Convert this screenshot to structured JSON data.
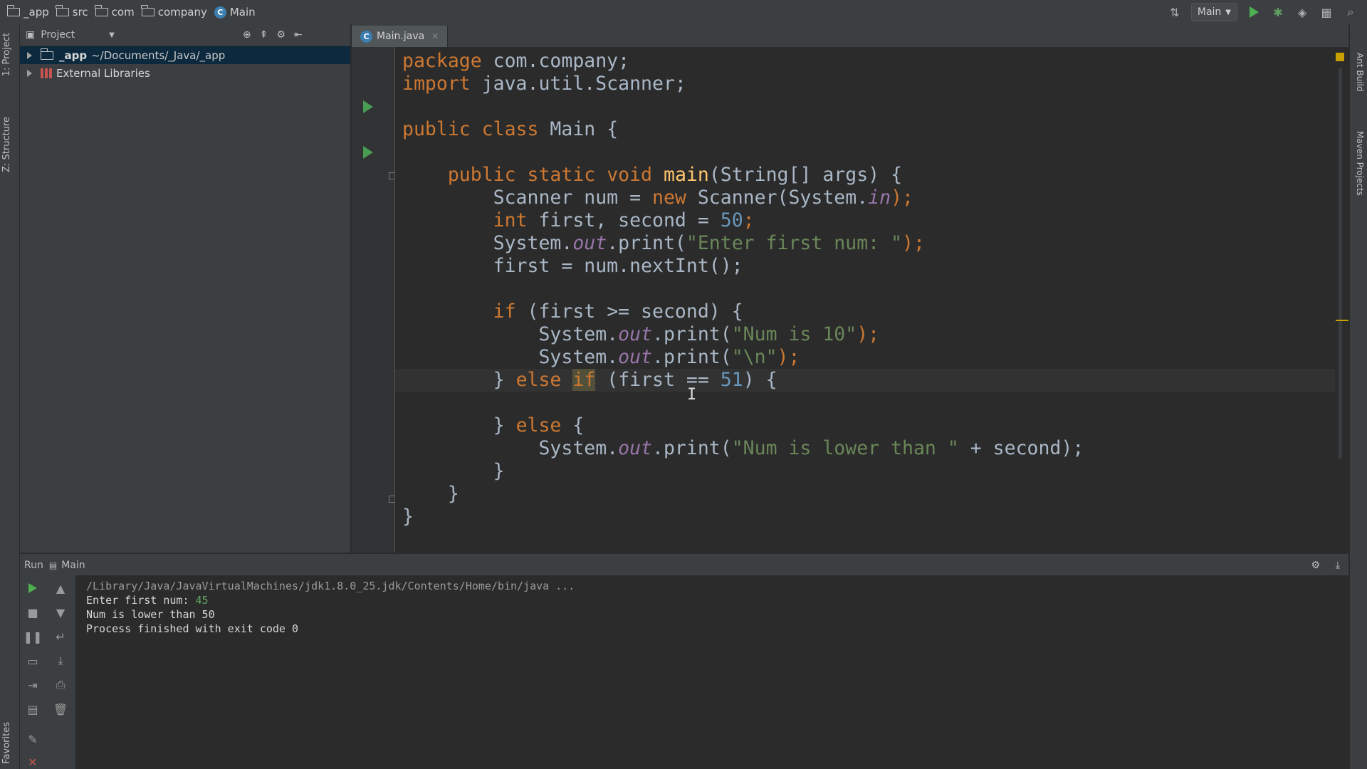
{
  "navbar": {
    "crumbs": [
      "_app",
      "src",
      "com",
      "company",
      "Main"
    ],
    "run_config": "Main"
  },
  "left_strip": {
    "project_tab": "1: Project",
    "structure_tab": "Z: Structure",
    "favorites_tab": "Favorites"
  },
  "right_strip": {
    "ant_tab": "Ant Build",
    "maven_tab": "Maven Projects"
  },
  "project_panel": {
    "title": "Project",
    "tree": [
      {
        "name": "_app",
        "path": "~/Documents/_Java/_app"
      },
      {
        "name": "External Libraries"
      }
    ]
  },
  "editor": {
    "tab_label": "Main.java",
    "code": {
      "l1_kw": "package",
      "l1_rest": " com.company;",
      "l2_kw": "import",
      "l2_rest": " java.util.Scanner;",
      "l4_kw": "public class",
      "l4_rest": " Main {",
      "l6_kw": "public static void",
      "l6_m": "main",
      "l6_rest": "(String[] args) {",
      "l7_a": "Scanner num = ",
      "l7_kw": "new",
      "l7_b": " Scanner(System.",
      "l7_f": "in",
      "l7_c": ");",
      "l8_kw": "int",
      "l8_a": " first, second = ",
      "l8_n": "50",
      "l8_c": ";",
      "l9_a": "System.",
      "l9_f": "out",
      "l9_b": ".print(",
      "l9_s": "\"Enter first num: \"",
      "l9_c": ");",
      "l10": "first = num.nextInt();",
      "l12_kw": "if",
      "l12_rest": " (first >= second) {",
      "l13_a": "System.",
      "l13_f": "out",
      "l13_b": ".print(",
      "l13_s": "\"Num is 10\"",
      "l13_c": ");",
      "l14_a": "System.",
      "l14_f": "out",
      "l14_b": ".print(",
      "l14_s": "\"\\n\"",
      "l14_c": ");",
      "l15_a": "} ",
      "l15_kw": "else",
      "l15_sp": " ",
      "l15_if": "if",
      "l15_b": " (first == ",
      "l15_n": "51",
      "l15_c": ") {",
      "l17_a": "} ",
      "l17_kw": "else",
      "l17_b": " {",
      "l18_a": "System.",
      "l18_f": "out",
      "l18_b": ".print(",
      "l18_s": "\"Num is lower than \"",
      "l18_c": " + second);",
      "l19": "}",
      "l20": "}",
      "l21": "}"
    }
  },
  "run_panel": {
    "label": "Run",
    "config": "Main",
    "console": {
      "cmd": "/Library/Java/JavaVirtualMachines/jdk1.8.0_25.jdk/Contents/Home/bin/java ...",
      "prompt": "Enter first num: ",
      "input": "45",
      "out1": "Num is lower than 50",
      "out2": "Process finished with exit code 0"
    }
  },
  "colors": {
    "keyword": "#cc7832",
    "number": "#6897bb",
    "string": "#6a8759",
    "field": "#9876aa",
    "method": "#ffc66d"
  }
}
